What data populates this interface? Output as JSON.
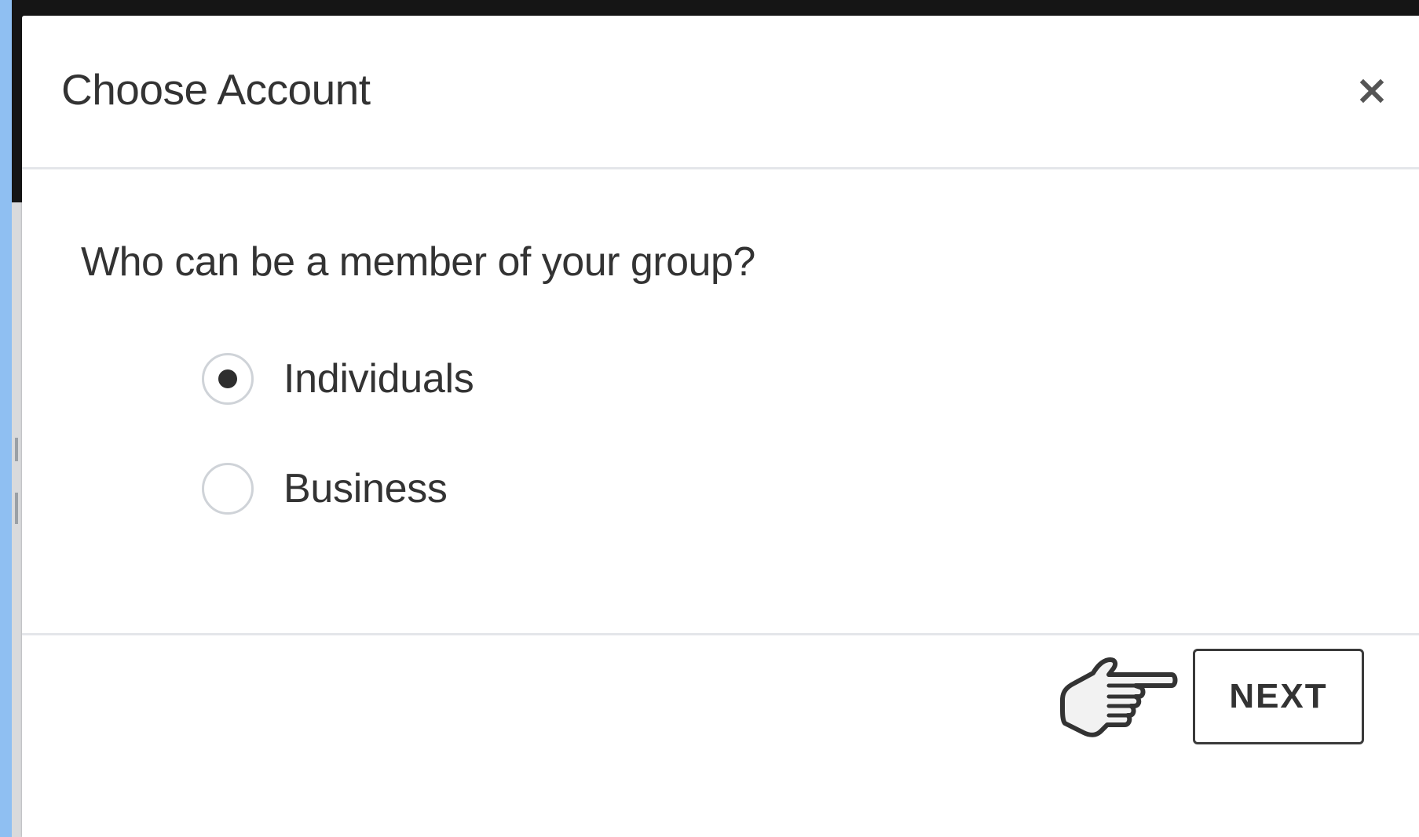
{
  "dialog": {
    "title": "Choose Account",
    "close_glyph": "×"
  },
  "body": {
    "question": "Who can be a member of your group?",
    "options": [
      {
        "label": "Individuals",
        "selected": true
      },
      {
        "label": "Business",
        "selected": false
      }
    ]
  },
  "footer": {
    "next_label": "NEXT"
  },
  "colors": {
    "outer_background": "#8fbff2",
    "backdrop": "#151515",
    "text": "#333333",
    "divider": "#e4e6ea"
  },
  "icons": {
    "close": "close-icon",
    "pointer": "pointing-hand-icon"
  }
}
